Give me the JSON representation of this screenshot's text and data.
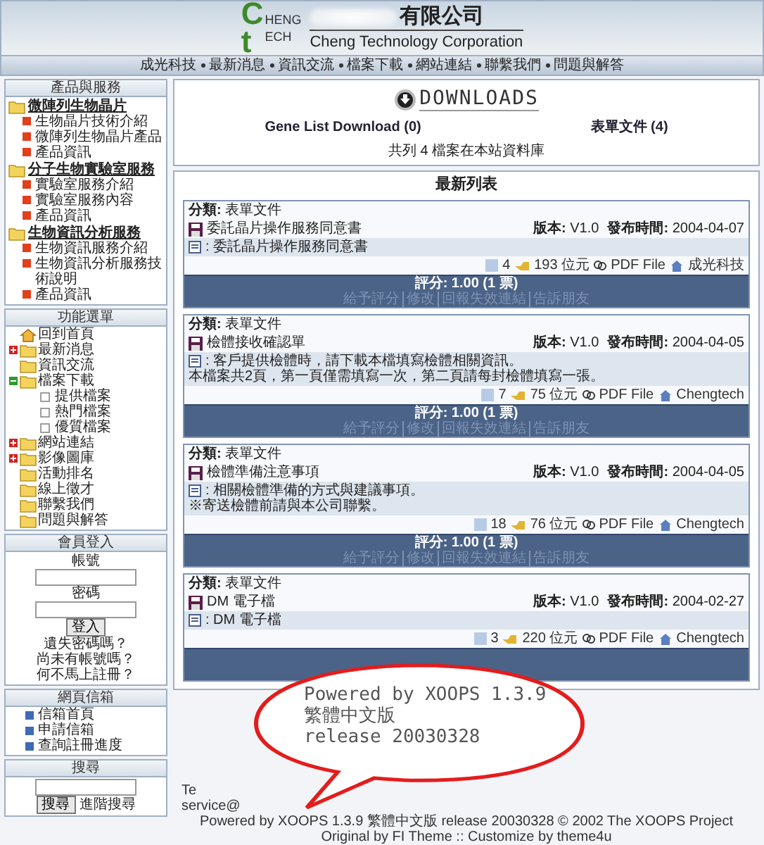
{
  "header": {
    "logo": {
      "initials": [
        "C",
        "t"
      ],
      "words": [
        "HENG",
        "ECH"
      ]
    },
    "company_suffix": "有限公司",
    "english_name": "Cheng Technology Corporation"
  },
  "nav": [
    "成光科技",
    "最新消息",
    "資訊交流",
    "檔案下載",
    "網站連結",
    "聯繫我們",
    "問題與解答"
  ],
  "sidebar": {
    "products": {
      "title": "產品與服務",
      "groups": [
        {
          "label": "微陣列生物晶片",
          "items": [
            "生物晶片技術介紹",
            "微陣列生物晶片產品",
            "產品資訊"
          ]
        },
        {
          "label": "分子生物實驗室服務",
          "items": [
            "實驗室服務介紹",
            "實驗室服務內容",
            "產品資訊"
          ]
        },
        {
          "label": "生物資訊分析服務",
          "items": [
            "生物資訊服務介紹",
            "生物資訊分析服務技術說明",
            "產品資訊"
          ]
        }
      ]
    },
    "menu": {
      "title": "功能選單",
      "items": [
        {
          "label": "回到首頁",
          "kind": "home"
        },
        {
          "label": "最新消息",
          "kind": "branch",
          "expanded": false
        },
        {
          "label": "資訊交流",
          "kind": "folder"
        },
        {
          "label": "檔案下載",
          "kind": "branch",
          "expanded": true,
          "children": [
            {
              "label": "提供檔案",
              "kind": "file"
            },
            {
              "label": "熱門檔案",
              "kind": "file"
            },
            {
              "label": "優質檔案",
              "kind": "file"
            }
          ]
        },
        {
          "label": "網站連結",
          "kind": "branch",
          "expanded": false
        },
        {
          "label": "影像圖庫",
          "kind": "branch",
          "expanded": false
        },
        {
          "label": "活動排名",
          "kind": "folder"
        },
        {
          "label": "線上徵才",
          "kind": "folder"
        },
        {
          "label": "聯繫我們",
          "kind": "folder"
        },
        {
          "label": "問題與解答",
          "kind": "folder"
        }
      ]
    },
    "login": {
      "title": "會員登入",
      "username_label": "帳號",
      "password_label": "密碼",
      "button": "登入",
      "lost_password": "遺失密碼嗎？",
      "no_account": "尚未有帳號嗎？",
      "register": "何不馬上註冊？"
    },
    "mail": {
      "title": "網頁信箱",
      "items": [
        "信箱首頁",
        "申請信箱",
        "查詢註冊進度"
      ]
    },
    "search": {
      "title": "搜尋",
      "button": "搜尋",
      "advanced": "進階搜尋"
    }
  },
  "downloads": {
    "logo_text": "DOWNLOADS",
    "categories": [
      {
        "name": "Gene List Download",
        "count": "(0)"
      },
      {
        "name": "表單文件",
        "count": "(4)"
      }
    ],
    "summary": "共列 4 檔案在本站資料庫"
  },
  "latest": {
    "title": "最新列表",
    "entries": [
      {
        "category": "**分類:** 表單文件",
        "title": "委託晶片操作服務同意書",
        "version": "**版本:** V1.0",
        "date": "**發布時間:** 2004-04-07",
        "description": [
          ": 委託晶片操作服務同意書"
        ],
        "downloads": "4",
        "size": "193 位元",
        "file_type": "PDF File",
        "submitter": "成光科技",
        "rating": "評分: 1.00 (1 票)",
        "actions": [
          "給予評分",
          "修改",
          "回報失效連結",
          "告訴朋友"
        ]
      },
      {
        "category": "**分類:** 表單文件",
        "title": "檢體接收確認單",
        "version": "**版本:** V1.0",
        "date": "**發布時間:** 2004-04-05",
        "description": [
          ": 客戶提供檢體時，請下載本檔填寫檢體相關資訊。",
          "本檔案共2頁，第一頁僅需填寫一次，第二頁請每封檢體填寫一張。"
        ],
        "downloads": "7",
        "size": "75 位元",
        "file_type": "PDF File",
        "submitter": "Chengtech",
        "rating": "評分: 1.00 (1 票)",
        "actions": [
          "給予評分",
          "修改",
          "回報失效連結",
          "告訴朋友"
        ]
      },
      {
        "category": "**分類:** 表單文件",
        "title": "檢體準備注意事項",
        "version": "**版本:** V1.0",
        "date": "**發布時間:** 2004-04-05",
        "description": [
          ": 相關檢體準備的方式與建議事項。",
          "※寄送檢體前請與本公司聯繫。"
        ],
        "downloads": "18",
        "size": "76 位元",
        "file_type": "PDF File",
        "submitter": "Chengtech",
        "rating": "評分: 1.00 (1 票)",
        "actions": [
          "給予評分",
          "修改",
          "回報失效連結",
          "告訴朋友"
        ]
      },
      {
        "category": "**分類:** 表單文件",
        "title": "DM 電子檔",
        "version": "**版本:** V1.0",
        "date": "**發布時間:** 2004-02-27",
        "description": [
          ": DM 電子檔"
        ],
        "downloads": "3",
        "size": "220 位元",
        "file_type": "PDF File",
        "submitter": "Chengtech"
      }
    ]
  },
  "footer": {
    "partial_lines": [
      "Te",
      "service@"
    ],
    "lines": [
      "Powered by XOOPS 1.3.9 繁體中文版 release 20030328 © 2002 The XOOPS Project",
      "Original by FI Theme :: Customize by theme4u"
    ]
  },
  "callout": {
    "lines": [
      "Powered by XOOPS 1.3.9",
      "繁體中文版",
      "release 20030328"
    ]
  }
}
